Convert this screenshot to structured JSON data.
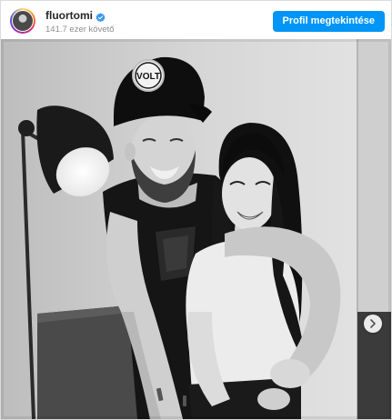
{
  "post": {
    "username": "fluortomi",
    "verified": true,
    "followers": "141.7 ezer követő",
    "view_profile_label": "Profil megtekintése"
  },
  "photo": {
    "cap_text": "VOLT"
  },
  "icons": {
    "verified": "verified-badge-icon",
    "next": "chevron-right-icon"
  },
  "colors": {
    "accent": "#0095f6",
    "verified": "#3897f0",
    "username": "#262626",
    "secondary_text": "#8e8e8e"
  }
}
